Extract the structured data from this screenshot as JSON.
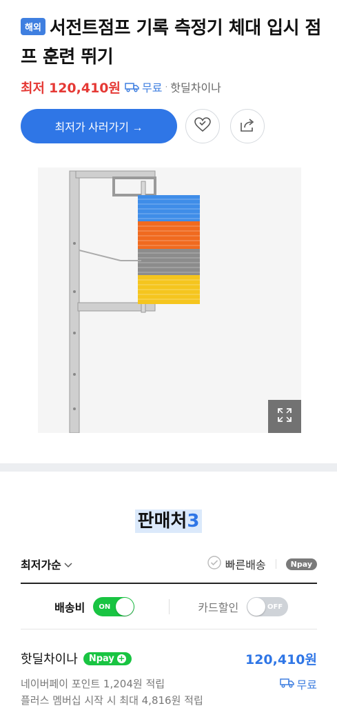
{
  "product": {
    "badge": "해외",
    "title": "서전트점프 기록 측정기 체대 입시 점프 훈련 뛰기",
    "lowest_label": "최저",
    "lowest_price": "120,410원",
    "shipping_free": "무료",
    "dot": "·",
    "seller": "핫딜차이나",
    "buy_button": "최저가 사러가기 →"
  },
  "sellers_section": {
    "heading": "판매처",
    "count": "3",
    "sort_label": "최저가순",
    "fast_shipping": "빠른배송",
    "npay": "Npay",
    "shipping_fee_label": "배송비",
    "shipping_toggle": "ON",
    "card_discount_label": "카드할인",
    "card_toggle": "OFF"
  },
  "offers": [
    {
      "seller": "핫딜차이나",
      "npay_label": "Npay",
      "price": "120,410원",
      "point_note": "네이버페이 포인트 1,204원 적립",
      "shipping": "무료",
      "membership_note": "플러스 멤버십 시작 시 최대 4,816원 적립"
    }
  ],
  "colors": {
    "accent": "#2f76e6",
    "price_red": "#e53935",
    "npay_green": "#19c442"
  }
}
